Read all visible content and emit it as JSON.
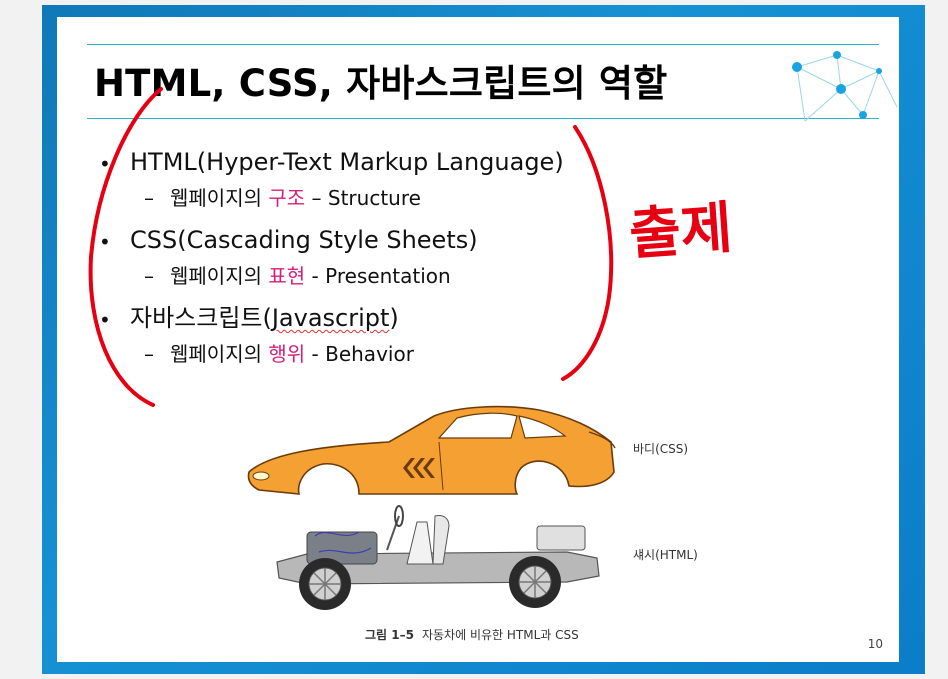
{
  "slide": {
    "title": "HTML, CSS, 자바스크립트의 역할",
    "page_number": "10"
  },
  "bullets": [
    {
      "main": "HTML(Hyper-Text Markup Language)",
      "sub_dash": "–",
      "sub_prefix": "웹페이지의",
      "sub_keyword": "구조",
      "sub_suffix": "– Structure"
    },
    {
      "main": "CSS(Cascading Style Sheets)",
      "sub_dash": "–",
      "sub_prefix": "웹페이지의",
      "sub_keyword": "표현",
      "sub_suffix": "- Presentation"
    },
    {
      "main_prefix": "자바스크립트(",
      "main_word": "Javascript",
      "main_suffix": ")",
      "sub_dash": "–",
      "sub_prefix": "웹페이지의",
      "sub_keyword": "행위",
      "sub_suffix": "- Behavior"
    }
  ],
  "annotation": {
    "handwritten_text": "출제",
    "ink_color": "#e60012"
  },
  "figure": {
    "body_label": "바디(CSS)",
    "chassis_label": "섀시(HTML)",
    "caption_number": "그림 1–5",
    "caption_text": "자동차에 비유한 HTML과 CSS"
  },
  "colors": {
    "frame_blue": "#1691d4",
    "rule_teal": "#2cb3c7",
    "keyword_magenta": "#d4207b",
    "car_orange": "#f5a033"
  }
}
